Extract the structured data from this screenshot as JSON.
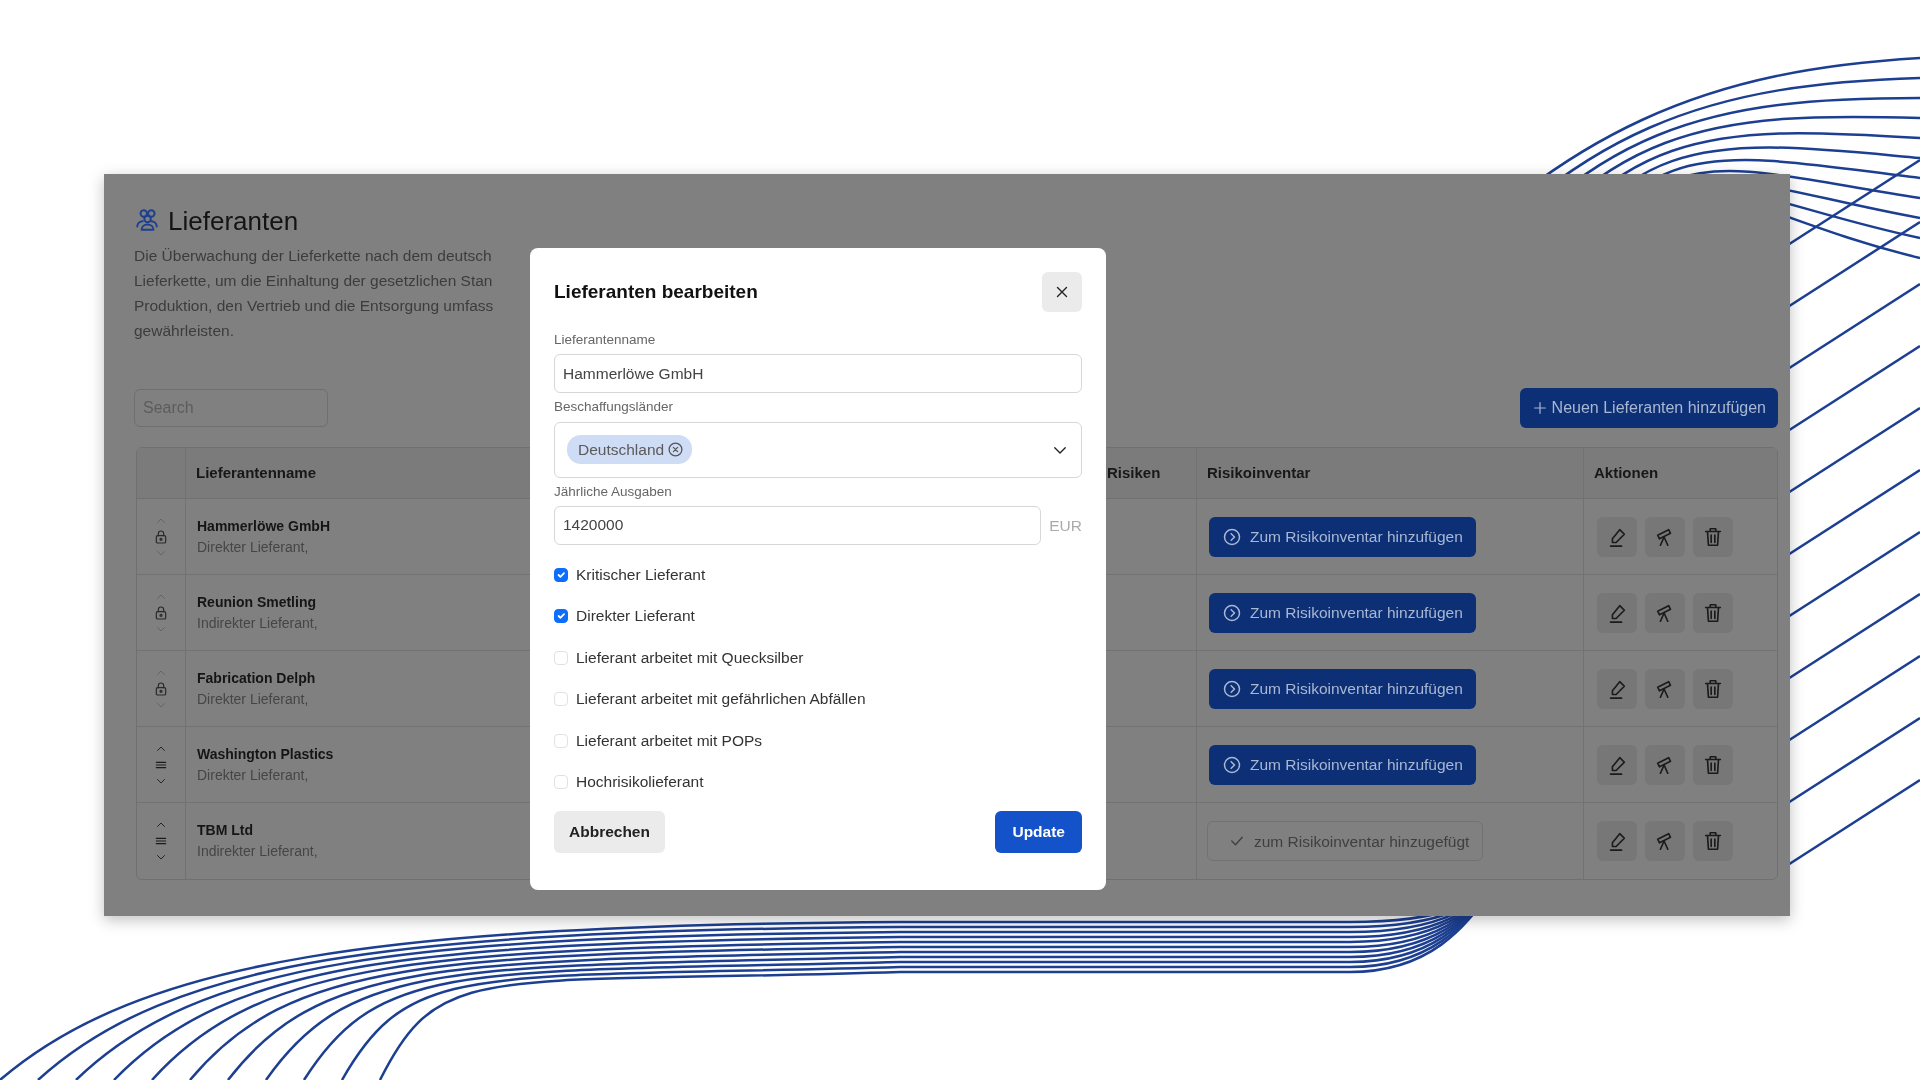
{
  "page": {
    "title": "Lieferanten",
    "description_lines": [
      "Die Überwachung der Lieferkette nach dem deutsch",
      "Lieferkette, um die Einhaltung der gesetzlichen Stan",
      "Produktion, den Vertrieb und die Entsorgung umfass",
      "gewährleisten."
    ],
    "search": {
      "placeholder": "Search"
    },
    "add_button": "Neuen Lieferanten hinzufügen"
  },
  "table": {
    "columns": [
      "Lieferantenname",
      "Risiken",
      "Risikoinventar",
      "Aktionen"
    ],
    "rows": [
      {
        "name": "Hammerlöwe GmbH",
        "type": "Direkter Lieferant,",
        "locked": true,
        "inventory": {
          "label": "Zum Risikoinventar hinzufügen",
          "added": false
        }
      },
      {
        "name": "Reunion Smetling",
        "type": "Indirekter Lieferant,",
        "locked": true,
        "inventory": {
          "label": "Zum Risikoinventar hinzufügen",
          "added": false
        }
      },
      {
        "name": "Fabrication Delph",
        "type": "Direkter Lieferant,",
        "locked": true,
        "inventory": {
          "label": "Zum Risikoinventar hinzufügen",
          "added": false
        }
      },
      {
        "name": "Washington Plastics",
        "type": "Direkter Lieferant,",
        "locked": false,
        "inventory": {
          "label": "Zum Risikoinventar hinzufügen",
          "added": false
        }
      },
      {
        "name": "TBM Ltd",
        "type": "Indirekter Lieferant,",
        "locked": false,
        "inventory": {
          "label": "zum Risikoinventar hinzugefügt",
          "added": true
        }
      }
    ]
  },
  "modal": {
    "title": "Lieferanten bearbeiten",
    "name_field": {
      "label": "Lieferantenname",
      "value": "Hammerlöwe GmbH"
    },
    "countries_field": {
      "label": "Beschaffungsländer",
      "chips": [
        "Deutschland"
      ]
    },
    "spend_field": {
      "label": "Jährliche Ausgaben",
      "value": "1420000",
      "unit": "EUR"
    },
    "checkboxes": [
      {
        "label": "Kritischer Lieferant",
        "checked": true
      },
      {
        "label": "Direkter Lieferant",
        "checked": true
      },
      {
        "label": "Lieferant arbeitet mit Quecksilber",
        "checked": false
      },
      {
        "label": "Lieferant arbeitet mit gefährlichen Abfällen",
        "checked": false
      },
      {
        "label": "Lieferant arbeitet mit POPs",
        "checked": false
      },
      {
        "label": "Hochrisikolieferant",
        "checked": false
      }
    ],
    "buttons": {
      "cancel": "Abbrechen",
      "submit": "Update"
    }
  }
}
